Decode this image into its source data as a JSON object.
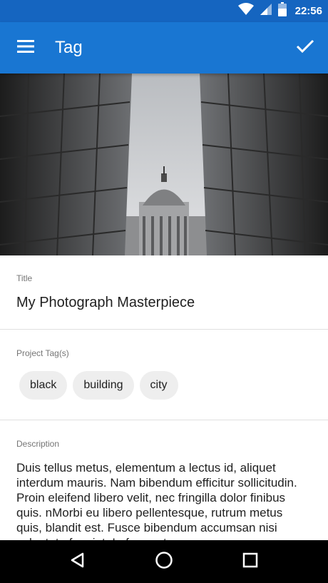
{
  "status_bar": {
    "time": "22:56",
    "icons": [
      "wifi-icon",
      "cell-signal-icon",
      "battery-icon"
    ]
  },
  "app_bar": {
    "title": "Tag",
    "menu_icon": "hamburger-menu-icon",
    "action_icon": "check-icon",
    "color": "#1976d2"
  },
  "form": {
    "title": {
      "label": "Title",
      "value": "My Photograph Masterpiece"
    },
    "tags": {
      "label": "Project Tag(s)",
      "items": [
        "black",
        "building",
        "city"
      ]
    },
    "description": {
      "label": "Description",
      "value": "Duis tellus metus, elementum a lectus id, aliquet interdum mauris. Nam bibendum efficitur sollicitudin. Proin eleifend libero velit, nec fringilla dolor finibus quis. nMorbi eu libero pellentesque, rutrum metus quis, blandit est. Fusce bibendum accumsan nisi vulputate feugiat. In fermentum"
    }
  },
  "nav_bar": {
    "icons": [
      "back-icon",
      "home-icon",
      "recents-icon"
    ]
  }
}
